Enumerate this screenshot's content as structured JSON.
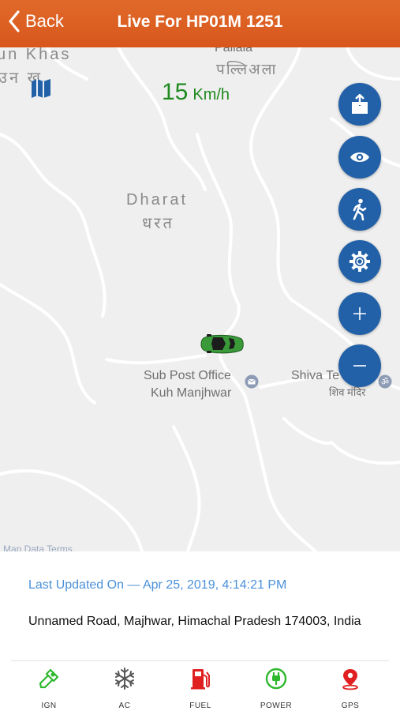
{
  "nav": {
    "back_label": "Back",
    "title": "Live For HP01M 1251"
  },
  "speed": {
    "value": "15",
    "unit": "Km/h"
  },
  "map": {
    "places": [
      {
        "id": "un-khas",
        "text": "un Khas"
      },
      {
        "id": "un-khas-hi",
        "text": "उन ख"
      },
      {
        "id": "pallala",
        "text": "Pallala"
      },
      {
        "id": "pallala-hi",
        "text": "पल्लिअला"
      },
      {
        "id": "dharat",
        "text": "Dharat"
      },
      {
        "id": "dharat-hi",
        "text": "धरत"
      },
      {
        "id": "subpost-1",
        "text": "Sub Post Office"
      },
      {
        "id": "subpost-2",
        "text": "Kuh Manjhwar"
      },
      {
        "id": "shiva",
        "text": "Shiva Te"
      },
      {
        "id": "shiva-hi",
        "text": "शिव मंदिर"
      },
      {
        "id": "attribution",
        "text": "i Map Data Terms"
      }
    ],
    "actions": [
      {
        "id": "share",
        "icon": "share-icon"
      },
      {
        "id": "view",
        "icon": "eye-icon"
      },
      {
        "id": "walk",
        "icon": "walk-icon"
      },
      {
        "id": "settings",
        "icon": "gear-icon"
      },
      {
        "id": "zoom-in",
        "icon": "plus-icon"
      },
      {
        "id": "zoom-out",
        "icon": "minus-icon"
      }
    ],
    "colors": {
      "background": "#efefef",
      "roads": "#ffffff",
      "action_button": "#2261a8",
      "car": "#3a9a3a"
    }
  },
  "info": {
    "last_updated": "Last Updated On — Apr 25, 2019, 4:14:21 PM",
    "address": "Unnamed Road, Majhwar, Himachal Pradesh 174003, India"
  },
  "status": [
    {
      "label": "IGN",
      "icon": "ignition-key-icon",
      "color": "#2eb82e"
    },
    {
      "label": "AC",
      "icon": "snowflake-icon",
      "color": "#555555"
    },
    {
      "label": "FUEL",
      "icon": "fuel-pump-icon",
      "color": "#e02020"
    },
    {
      "label": "POWER",
      "icon": "power-plug-icon",
      "color": "#2eb82e"
    },
    {
      "label": "GPS",
      "icon": "gps-pin-icon",
      "color": "#e02020"
    }
  ],
  "colors": {
    "navbar": "#dc5f22",
    "speed": "#1f8a1f",
    "last_updated": "#4a90d9"
  }
}
